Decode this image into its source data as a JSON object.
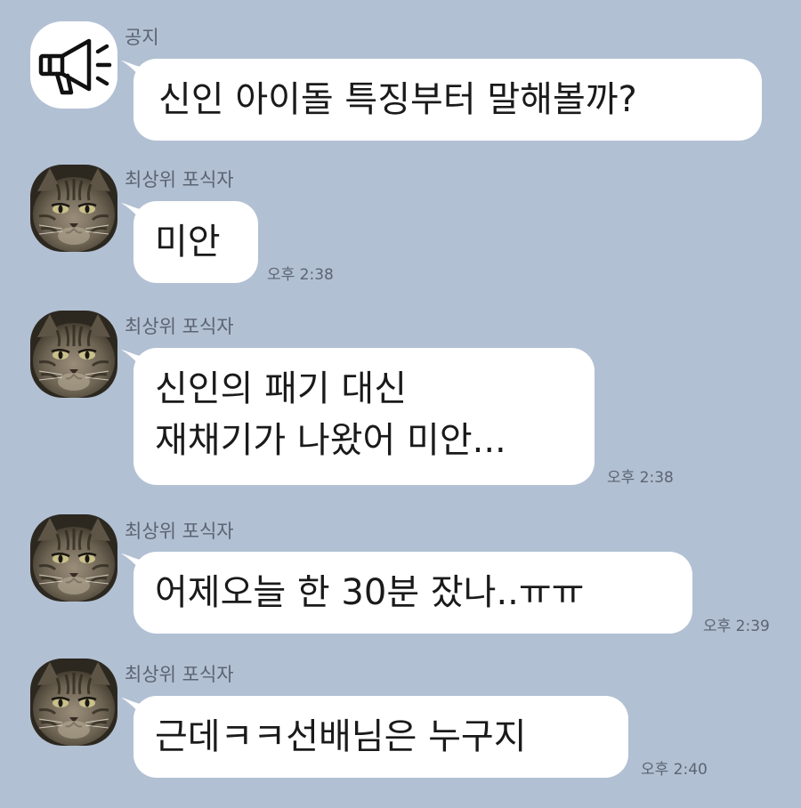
{
  "messages": [
    {
      "sender": "공지",
      "avatar_icon": "megaphone-icon",
      "lines": [
        "신인 아이돌 특징부터 말해볼까?"
      ],
      "time": ""
    },
    {
      "sender": "최상위 포식자",
      "avatar_icon": "cat-avatar",
      "lines": [
        "미안"
      ],
      "time": "오후 2:38"
    },
    {
      "sender": "최상위 포식자",
      "avatar_icon": "cat-avatar",
      "lines": [
        "신인의 패기 대신",
        "재채기가 나왔어 미안..."
      ],
      "time": "오후 2:38"
    },
    {
      "sender": "최상위 포식자",
      "avatar_icon": "cat-avatar",
      "lines": [
        "어제오늘 한 30분 잤나..ㅠㅠ"
      ],
      "time": "오후 2:39"
    },
    {
      "sender": "최상위 포식자",
      "avatar_icon": "cat-avatar",
      "lines": [
        "근데ㅋㅋ선배님은 누구지"
      ],
      "time": "오후 2:40"
    }
  ],
  "colors": {
    "background": "#b2c0d3",
    "bubble": "#ffffff",
    "meta_text": "#5b6472"
  }
}
